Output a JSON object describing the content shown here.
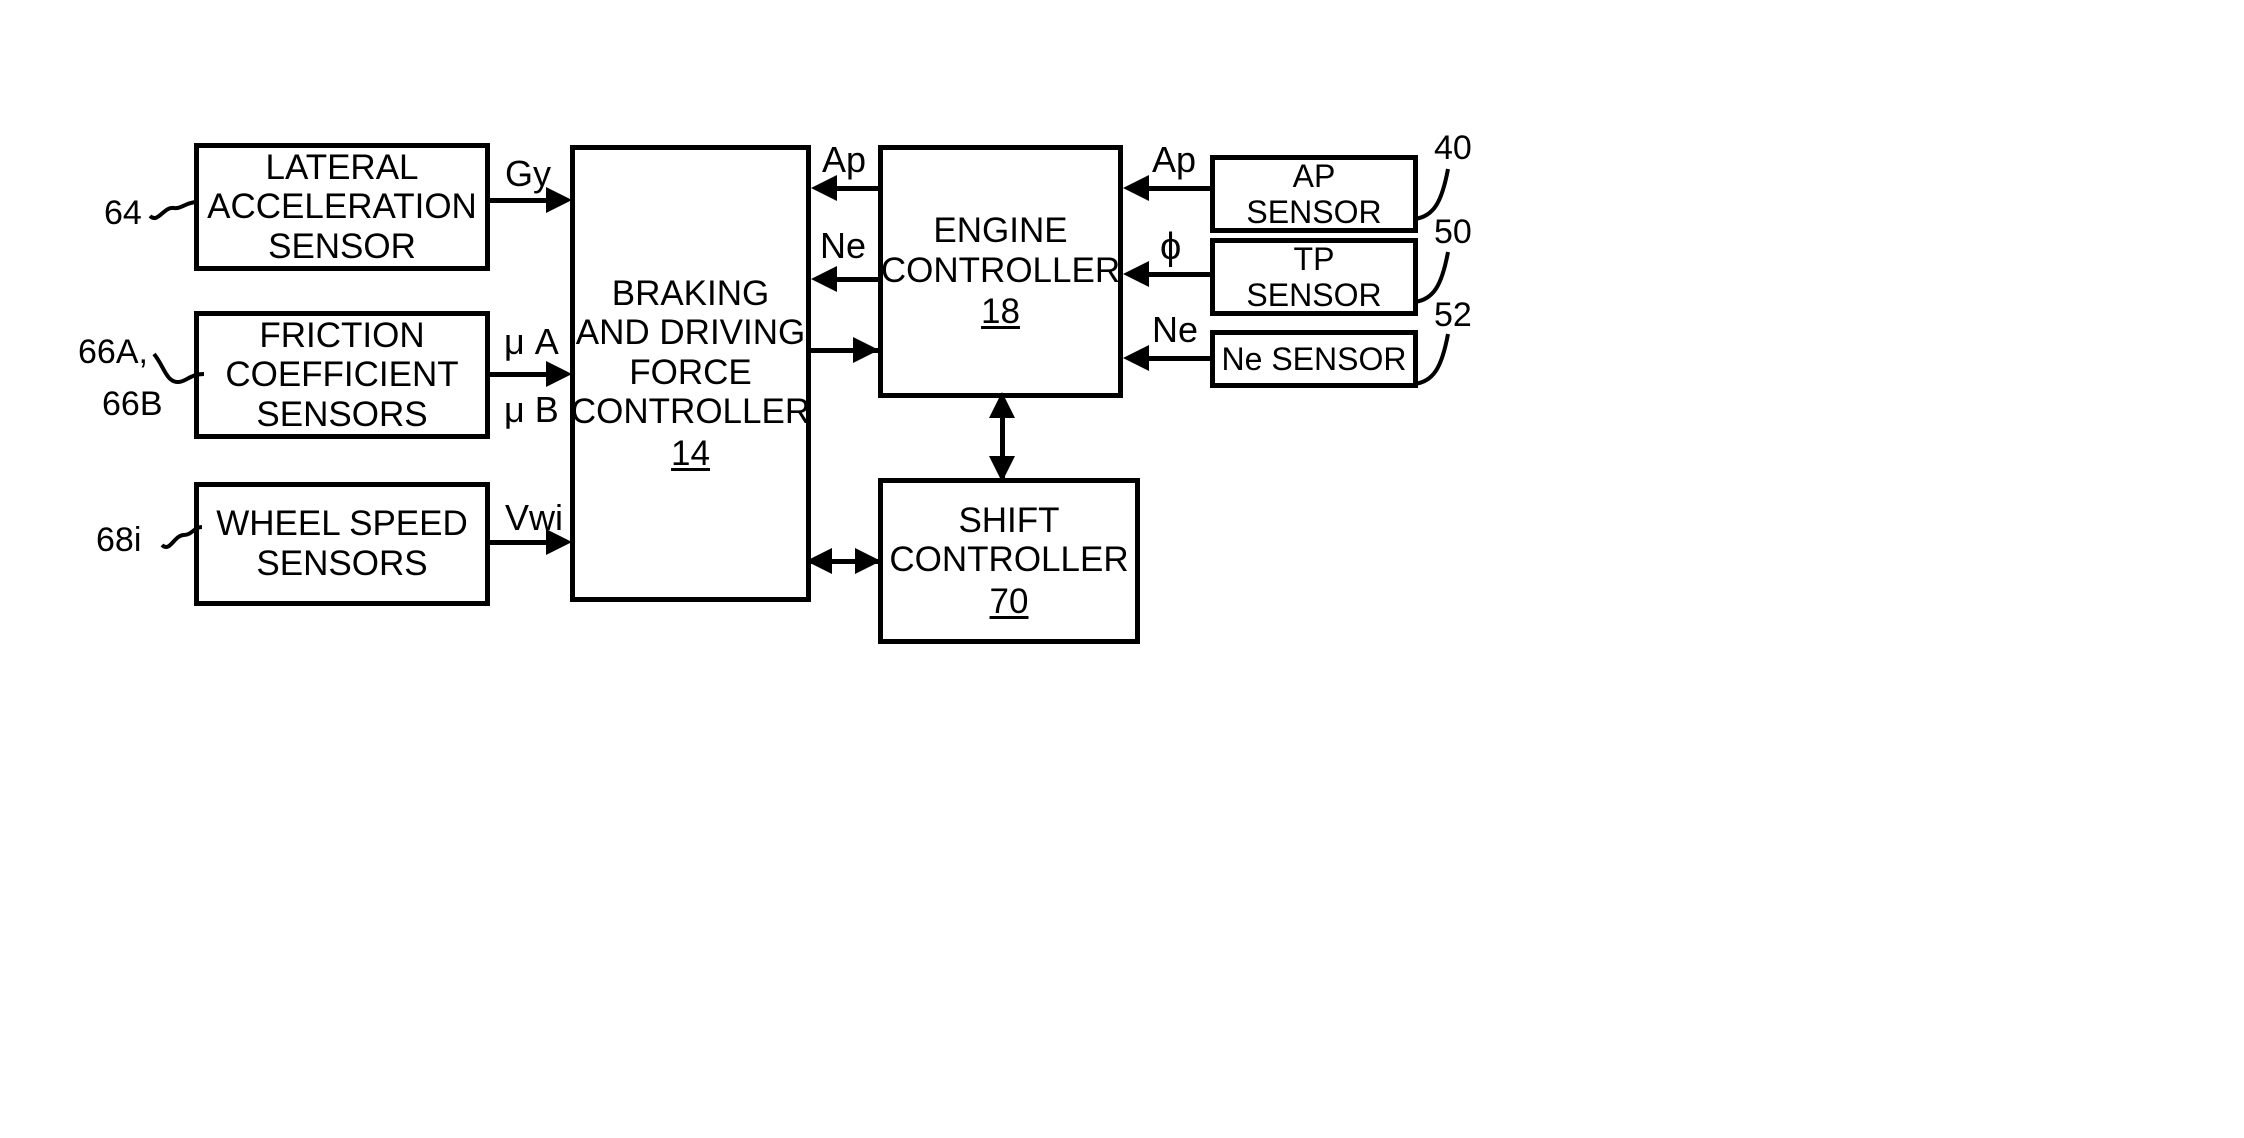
{
  "figure": {
    "type": "patent-block-diagram",
    "background": "#ffffff",
    "stroke": "#000000"
  },
  "blocks": {
    "lateral_accel_sensor": {
      "lines": [
        "LATERAL",
        "ACCELERATION",
        "SENSOR"
      ],
      "ref": "64"
    },
    "friction_coefficient_sensors": {
      "lines": [
        "FRICTION",
        "COEFFICIENT",
        "SENSORS"
      ],
      "ref_line1": "66A,",
      "ref_line2": "66B"
    },
    "wheel_speed_sensors": {
      "lines": [
        "WHEEL SPEED",
        "SENSORS"
      ],
      "ref": "68i"
    },
    "braking_driving_force_controller": {
      "lines": [
        "BRAKING",
        "AND DRIVING",
        "FORCE",
        "CONTROLLER"
      ],
      "refnum": "14"
    },
    "engine_controller": {
      "lines": [
        "ENGINE",
        "CONTROLLER"
      ],
      "refnum": "18"
    },
    "shift_controller": {
      "lines": [
        "SHIFT",
        "CONTROLLER"
      ],
      "refnum": "70"
    },
    "ap_sensor": {
      "lines": [
        "AP",
        "SENSOR"
      ],
      "ref": "40"
    },
    "tp_sensor": {
      "lines": [
        "TP",
        "SENSOR"
      ],
      "ref": "50"
    },
    "ne_sensor": {
      "lines": [
        "Ne SENSOR"
      ],
      "ref": "52"
    }
  },
  "signals": {
    "gy": "Gy",
    "mu_a": "μ A",
    "mu_b": "μ B",
    "vwi": "Vwi",
    "ap_left": "Ap",
    "ne_left": "Ne",
    "ap_right": "Ap",
    "phi": "ϕ",
    "ne_right": "Ne"
  }
}
